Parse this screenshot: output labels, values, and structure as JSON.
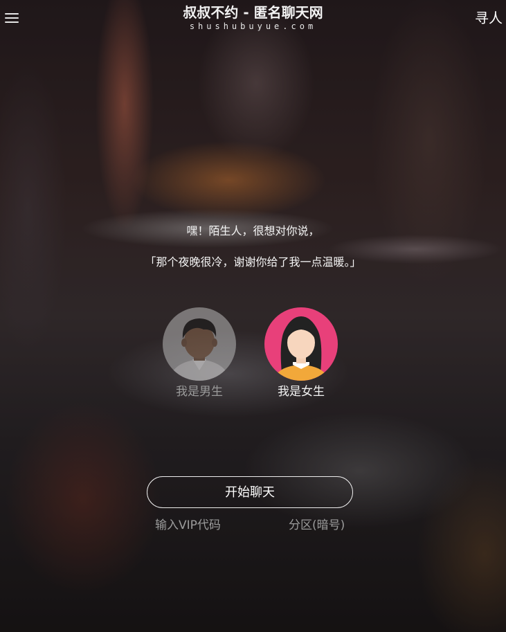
{
  "header": {
    "menu_icon": "hamburger-menu-icon",
    "title": "叔叔不约 - 匿名聊天网",
    "domain": "shushubuyue.com",
    "find_link": "寻人"
  },
  "message": {
    "line1": "嘿！陌生人，很想对你说，",
    "line2": "「那个夜晚很冷，谢谢你给了我一点温暖。」"
  },
  "gender": {
    "male_label": "我是男生",
    "female_label": "我是女生",
    "selected": "female",
    "male_icon": "male-avatar-icon",
    "female_icon": "female-avatar-icon"
  },
  "actions": {
    "start_label": "开始聊天",
    "vip_label": "输入VIP代码",
    "zone_label": "分区(暗号)"
  },
  "colors": {
    "female_ring": "#e8407a",
    "male_ring": "#9a9a9a",
    "button_border": "#eeeeee"
  }
}
